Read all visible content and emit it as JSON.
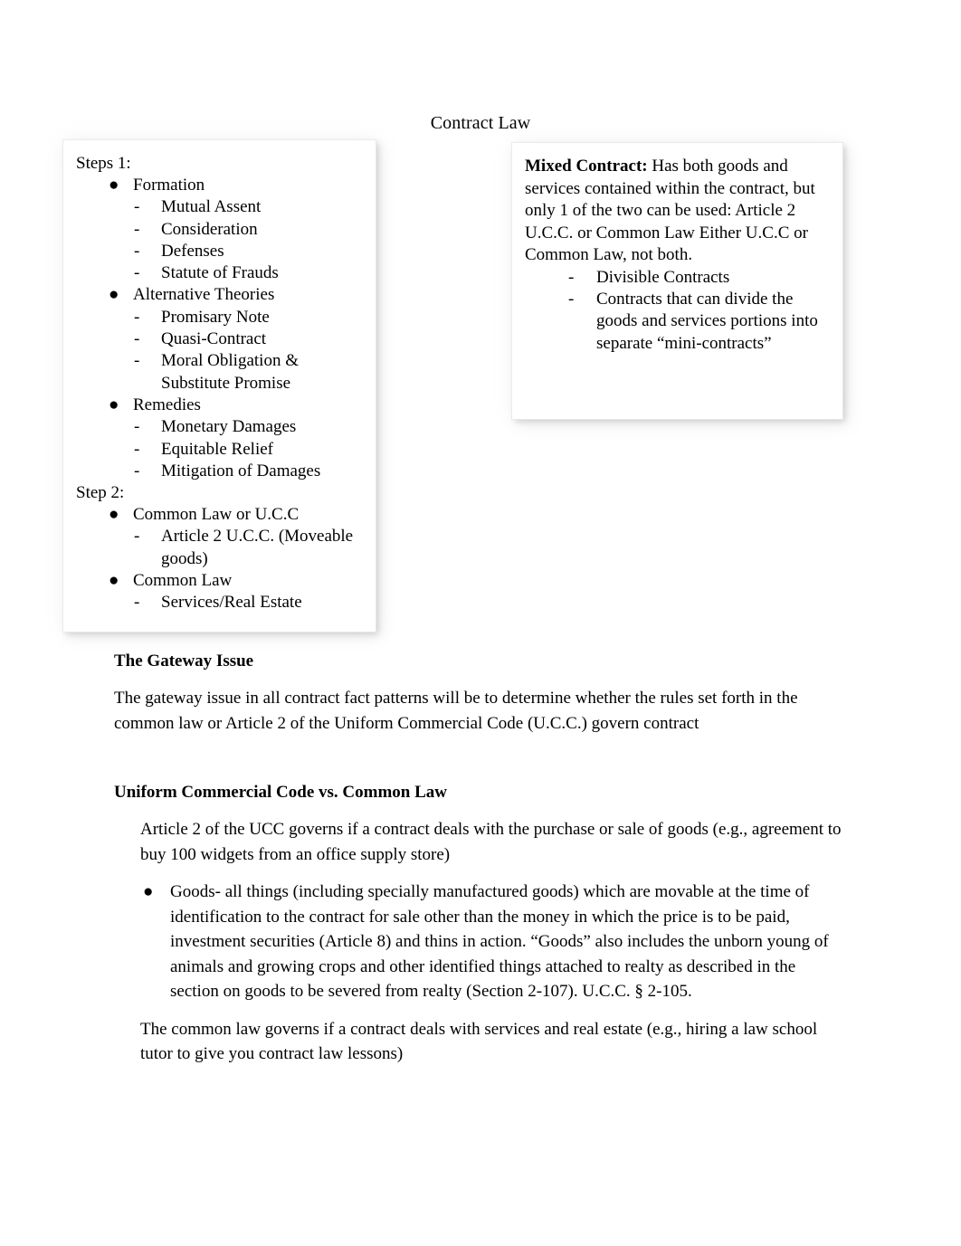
{
  "document": {
    "title": "Contract Law"
  },
  "left_box": {
    "step1_label": "Steps 1:",
    "step2_label": "Step 2:",
    "step1_items": [
      {
        "label": "Formation",
        "sub": [
          "Mutual Assent",
          "Consideration",
          "Defenses",
          "Statute of Frauds"
        ]
      },
      {
        "label": "Alternative Theories",
        "sub": [
          "Promisary Note",
          "Quasi-Contract",
          "Moral Obligation & Substitute Promise"
        ]
      },
      {
        "label": "Remedies",
        "sub": [
          "Monetary Damages",
          "Equitable Relief",
          "Mitigation of Damages"
        ]
      }
    ],
    "step2_items": [
      {
        "label": "Common Law or U.C.C",
        "sub": [
          "Article 2 U.C.C. (Moveable goods)"
        ]
      },
      {
        "label": "Common Law",
        "sub": [
          "Services/Real Estate"
        ]
      }
    ]
  },
  "right_box": {
    "heading": "Mixed Contract:",
    "paragraph": " Has both goods and services contained within the contract, but only 1 of the two can be used: Article 2 U.C.C. or Common Law Either U.C.C or Common Law, not both.",
    "sub_items": [
      "Divisible Contracts",
      "Contracts that can divide the goods and services portions into separate “mini-contracts”"
    ]
  },
  "body": {
    "gateway_heading": "The Gateway Issue",
    "gateway_paragraph": "The gateway issue in all contract fact patterns will be to determine whether the rules set forth in the common law or Article 2 of the Uniform Commercial Code (U.C.C.) govern contract",
    "ucc_heading": "Uniform Commercial Code vs. Common Law",
    "ucc_paragraph": "Article 2 of the UCC governs if a contract deals with the purchase or sale of goods (e.g., agreement to buy 100 widgets from an office supply store)",
    "goods_bullet": "Goods- all things (including specially manufactured goods) which are movable at the time of identification to the contract for sale other than the money in which the price is to be paid, investment securities (Article 8) and thins in action. “Goods” also includes the unborn young of animals and growing crops and other identified things attached to realty as described in the section on goods to be severed from realty (Section 2-107). U.C.C. § 2-105.",
    "common_law_paragraph": "The common law governs if a contract deals with services and real estate (e.g., hiring a law school tutor to give you contract law lessons)"
  },
  "glyphs": {
    "bullet": "●",
    "dash": "-"
  },
  "colors": {
    "text": "#000000",
    "page_background": "#ffffff",
    "box_shadow": "#c8c8c8"
  }
}
